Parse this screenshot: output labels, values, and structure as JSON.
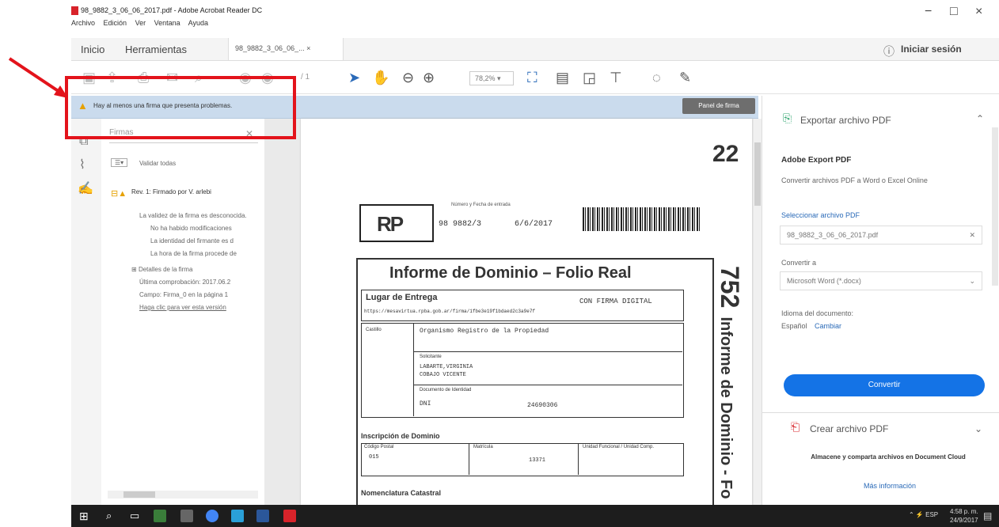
{
  "window": {
    "title": "98_9882_3_06_06_2017.pdf - Adobe Acrobat Reader DC",
    "menu": [
      "Archivo",
      "Edición",
      "Ver",
      "Ventana",
      "Ayuda"
    ],
    "controls": [
      "−",
      "□",
      "×"
    ]
  },
  "tabs": {
    "home": "Inicio",
    "tools": "Herramientas",
    "file": "98_9882_3_06_06_... ×",
    "signin": "Iniciar sesión"
  },
  "toolbar": {
    "page": "/ 1",
    "zoom": "78,2%"
  },
  "warning": {
    "message": "Hay al menos una firma que presenta problemas.",
    "panel_button": "Panel de firma"
  },
  "signatures": {
    "search": "Firmas",
    "validate_all": "Validar todas",
    "rev": "Rev. 1: Firmado por V.          arlebi",
    "details": [
      "La validez de la firma es desconocida.",
      "No ha habido modificaciones",
      "La identidad del firmante es d",
      "La hora de la firma procede de"
    ],
    "detail_header": "Detalles de la firma",
    "last_check": "Última comprobación: 2017.06.2",
    "field": "Campo: Firma_0 en la página 1",
    "view_version": "Haga clic para ver esta versión"
  },
  "document": {
    "page_num": "22",
    "entry_label": "Número y Fecha de entrada",
    "entry_number": "98 9882/3",
    "entry_date": "6/6/2017",
    "side_number": "752",
    "side_text": "Informe de Dominio - Fo",
    "title": "Informe de Dominio – Folio Real",
    "place_label": "Lugar de Entrega",
    "digital_sig": "CON FIRMA DIGITAL",
    "url": "https://mesavirtua.rpba.gob.ar/firma/1fbe3e19f1bdaed2c3a9e7f",
    "castillo": "Castillo",
    "org": "Organismo Registro de la Propiedad",
    "solicitante_label": "Solicitante",
    "solicitante_name1": "LABARTE,VIRGINIA",
    "solicitante_name2": "COBAJO VICENTE",
    "id_label": "Documento de Identidad",
    "id_type": "DNI",
    "id_number": "24690306",
    "inscr_title": "Inscripción de Dominio",
    "postal_label": "Código Postal",
    "postal_val": "015",
    "matricula_label": "Matrícula",
    "matricula_val": "13371",
    "unidad_label": "Unidad Funcional / Unidad Comp.",
    "nomen_title": "Nomenclatura Catastral",
    "rpba_logo": "RP"
  },
  "right_panel": {
    "export_title": "Exportar archivo PDF",
    "adobe_export": "Adobe Export PDF",
    "adobe_desc": "Convertir archivos PDF a Word o Excel Online",
    "select_label": "Seleccionar archivo PDF",
    "file_name": "98_9882_3_06_06_2017.pdf",
    "convert_to": "Convertir a",
    "format": "Microsoft Word (*.docx)",
    "lang_label": "Idioma del documento:",
    "lang_value": "Español",
    "lang_change": "Cambiar",
    "convert_btn": "Convertir",
    "create_title": "Crear archivo PDF",
    "cloud_text": "Almacene y comparta archivos en Document Cloud",
    "more_info": "Más información"
  },
  "taskbar": {
    "time": "4:58 p. m.",
    "date": "24/9/2017",
    "lang": "ESP"
  },
  "colors": {
    "warning_bar": "#cadbed",
    "annotation": "#e3131b",
    "accent": "#1473e6"
  }
}
